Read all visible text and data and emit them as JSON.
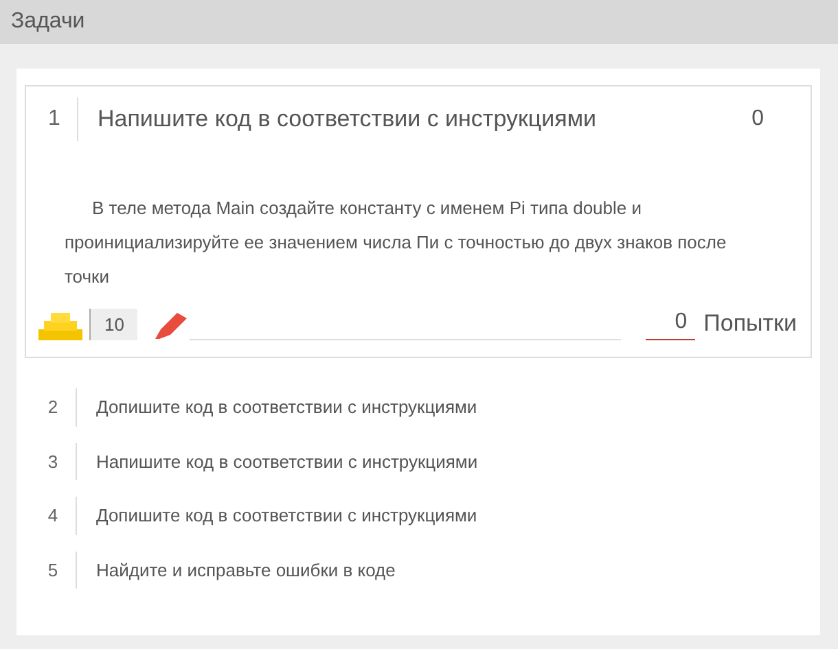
{
  "header": {
    "title": "Задачи"
  },
  "tasks": [
    {
      "number": "1",
      "title": "Напишите код в соответствии с инструкциями",
      "expanded": true,
      "score": "0",
      "description": "В теле метода Main создайте константу с именем Pi типа double и проинициализируйте ее значением числа Пи с точностью до двух знаков после точки",
      "points": "10",
      "attempts": "0",
      "attempts_label": "Попытки"
    },
    {
      "number": "2",
      "title": "Допишите код в соответствии с инструкциями",
      "expanded": false
    },
    {
      "number": "3",
      "title": "Напишите код в соответствии с инструкциями",
      "expanded": false
    },
    {
      "number": "4",
      "title": "Допишите код в соответствии с инструкциями",
      "expanded": false
    },
    {
      "number": "5",
      "title": "Найдите и исправьте ошибки в коде",
      "expanded": false
    }
  ]
}
